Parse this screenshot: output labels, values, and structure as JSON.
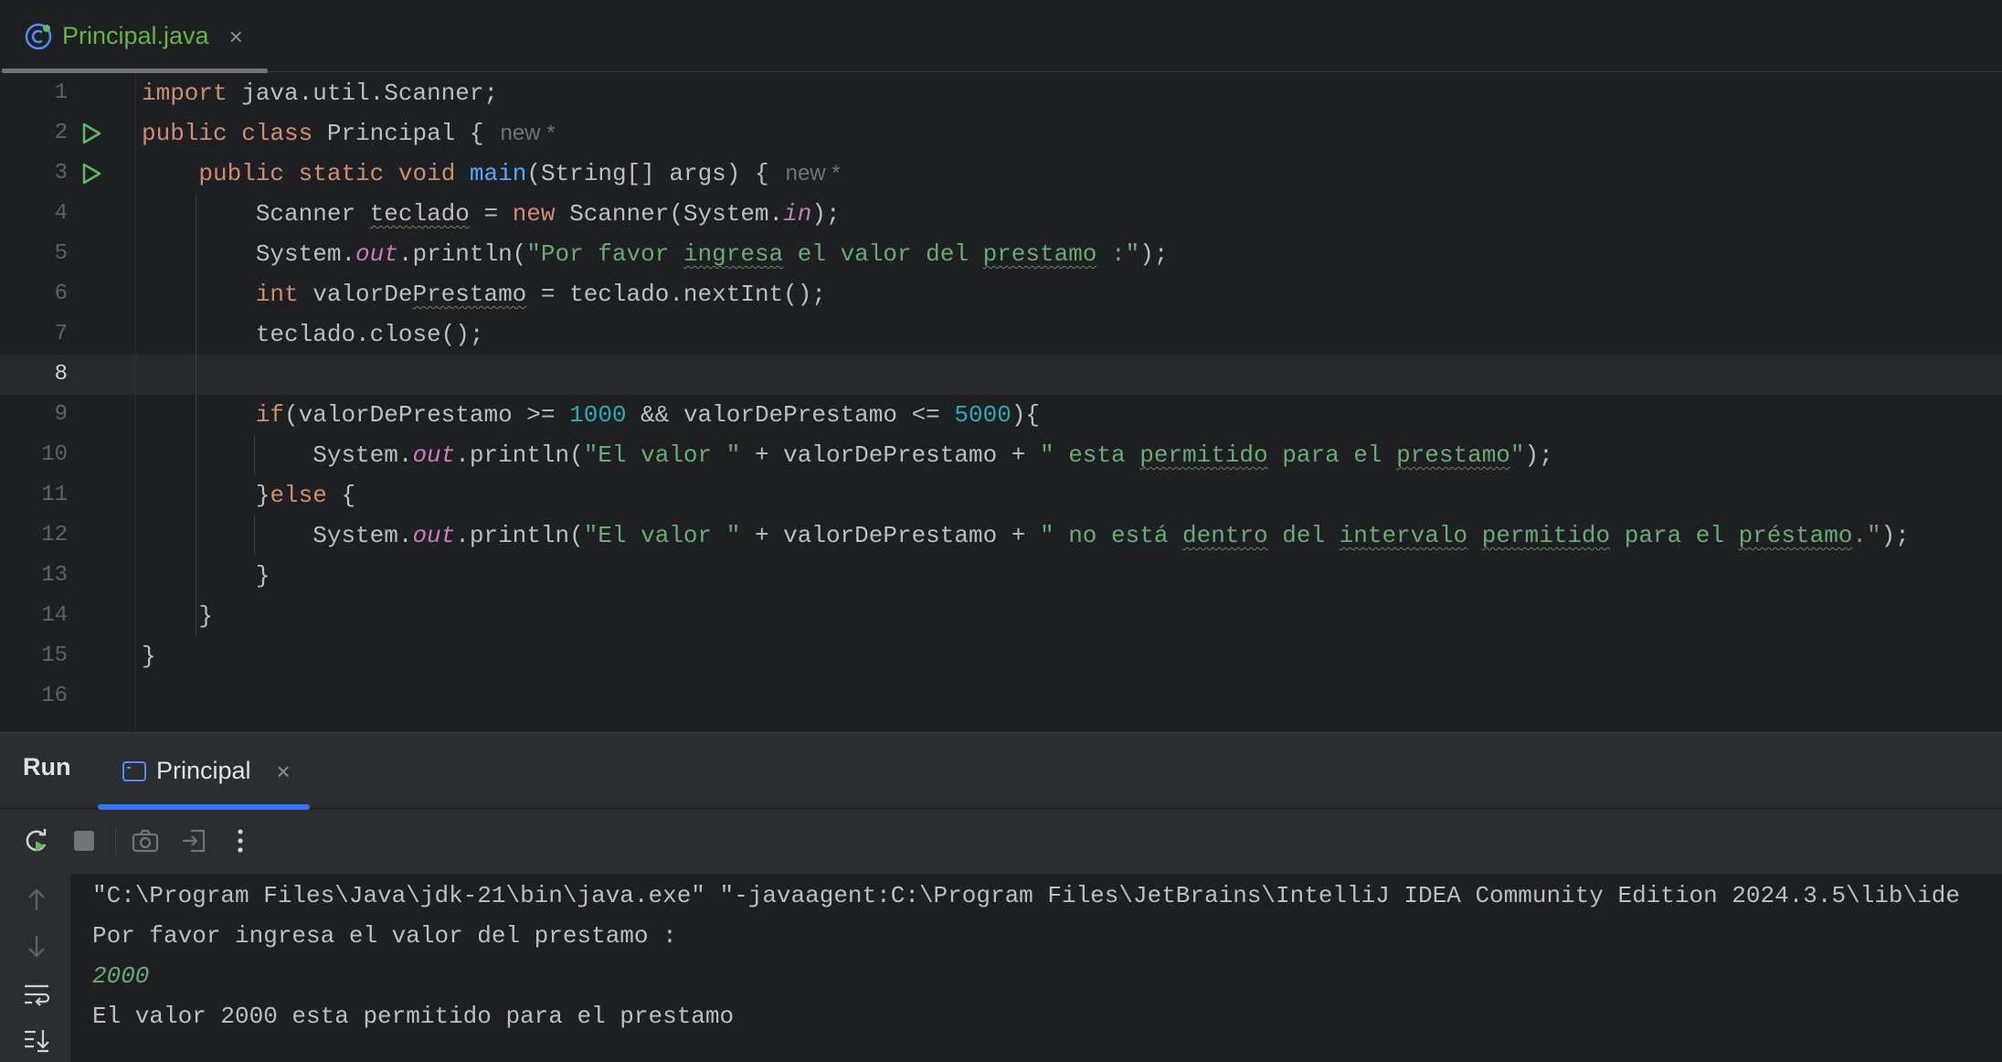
{
  "editor_tab": {
    "label": "Principal.java",
    "close": "×",
    "icon": "java-class-icon"
  },
  "gutter": {
    "line_numbers": [
      "1",
      "2",
      "3",
      "4",
      "5",
      "6",
      "7",
      "8",
      "9",
      "10",
      "11",
      "12",
      "13",
      "14",
      "15",
      "16"
    ],
    "run_icons_on_lines": [
      2,
      3
    ],
    "current_line": 8
  },
  "code": {
    "l1": {
      "kw": "import",
      "rest": " java.util.Scanner;"
    },
    "l2": {
      "kw1": "public",
      "kw2": "class",
      "rest": " Principal {",
      "inlay": "new *"
    },
    "l3": {
      "kw1": "public",
      "kw2": "static",
      "kw3": "void",
      "fn": "main",
      "rest": "(String[] args) {",
      "inlay": "new *"
    },
    "l4": {
      "a": "Scanner ",
      "var": "teclado",
      "b": " = ",
      "kw": "new",
      "c": " Scanner(System.",
      "fld": "in",
      "d": ");"
    },
    "l5": {
      "a": "System.",
      "fld": "out",
      "b": ".println(",
      "s1": "\"Por favor ",
      "s2": "ingresa",
      "s3": " el valor del ",
      "s4": "prestamo",
      "s5": " :\"",
      "c": ");"
    },
    "l6": {
      "kw": "int",
      "a": " valorDe",
      "var": "Prestamo",
      "b": " = teclado.nextInt();"
    },
    "l7": {
      "a": "teclado.close();"
    },
    "l9": {
      "kw": "if",
      "a": "(valorDePrestamo >= ",
      "n1": "1000",
      "b": " && valorDePrestamo <= ",
      "n2": "5000",
      "c": "){"
    },
    "l10": {
      "a": "System.",
      "fld": "out",
      "b": ".println(",
      "s1": "\"El valor \"",
      "c": " + valorDePrestamo + ",
      "s2": "\" esta ",
      "s3": "permitido",
      "s4": " para el ",
      "s5": "prestamo",
      "s6": "\"",
      "d": ");"
    },
    "l11": {
      "a": "}",
      "kw": "else",
      "b": " {"
    },
    "l12": {
      "a": "System.",
      "fld": "out",
      "b": ".println(",
      "s1": "\"El valor \"",
      "c": " + valorDePrestamo + ",
      "s2": "\" no está ",
      "s3": "dentro",
      "s4": " del ",
      "s5": "intervalo",
      "s6": " ",
      "s7": "permitido",
      "s8": " para el ",
      "s9": "préstamo",
      "s10": ".\"",
      "d": ");"
    },
    "l13": {
      "a": "}"
    },
    "l14": {
      "a": "}"
    },
    "l15": {
      "a": "}"
    }
  },
  "run_panel": {
    "title": "Run",
    "tab_label": "Principal",
    "tab_close": "×",
    "toolbar_icons": [
      "rerun-icon",
      "stop-icon",
      "camera-icon",
      "exit-icon",
      "more-icon"
    ],
    "side_icons": [
      "up-arrow-icon",
      "down-arrow-icon",
      "soft-wrap-icon",
      "scroll-to-end-icon"
    ]
  },
  "console": {
    "lines": [
      "\"C:\\Program Files\\Java\\jdk-21\\bin\\java.exe\" \"-javaagent:C:\\Program Files\\JetBrains\\IntelliJ IDEA Community Edition 2024.3.5\\lib\\ide",
      "Por favor ingresa el valor del prestamo :",
      "2000",
      "El valor 2000 esta permitido para el prestamo"
    ]
  },
  "colors": {
    "background": "#1e1f22",
    "keyword": "#cf8e6d",
    "string": "#6aab73",
    "number": "#2aacb8",
    "field": "#c77dbb",
    "function": "#56a8f5",
    "accent": "#3574f0",
    "run_green": "#5fb865"
  }
}
